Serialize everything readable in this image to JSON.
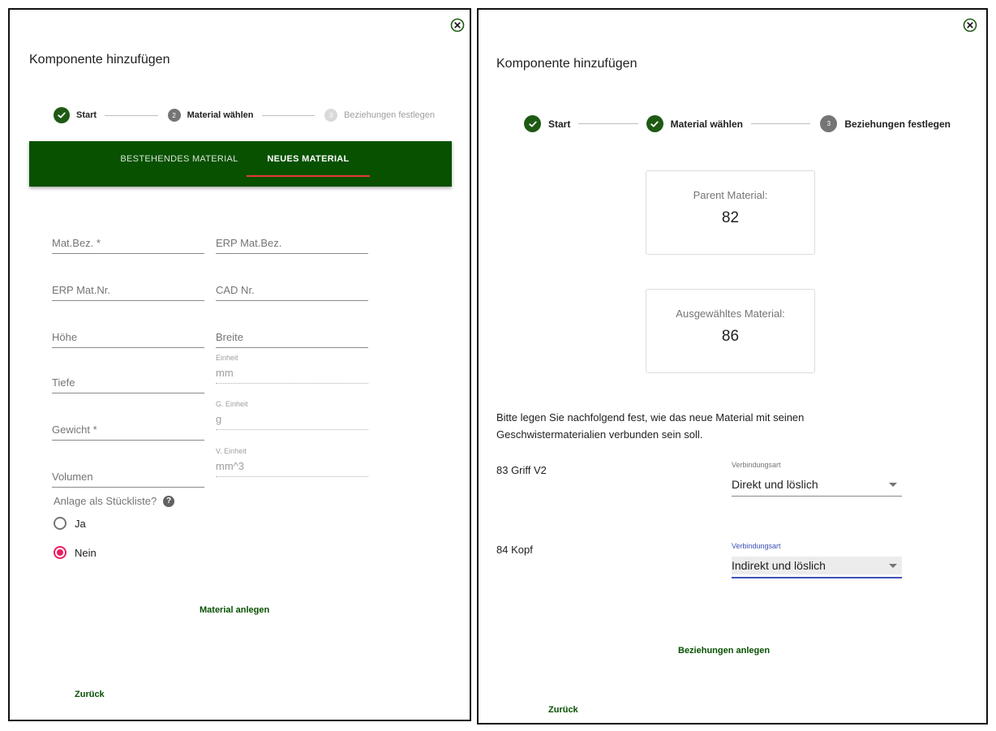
{
  "left": {
    "title": "Komponente hinzufügen",
    "stepper": [
      {
        "label": "Start",
        "state": "done"
      },
      {
        "number": "2",
        "label": "Material wählen",
        "state": "active"
      },
      {
        "number": "3",
        "label": "Beziehungen festlegen",
        "state": "pending"
      }
    ],
    "tabs": {
      "existing": "BESTEHENDES MATERIAL",
      "new": "NEUES MATERIAL",
      "selected": "new"
    },
    "fields": {
      "mat_bez": {
        "label": "",
        "placeholder": "Mat.Bez. *"
      },
      "erp_mat_bez": {
        "label": "",
        "placeholder": "ERP Mat.Bez."
      },
      "erp_mat_nr": {
        "label": "",
        "placeholder": "ERP Mat.Nr."
      },
      "cad_nr": {
        "label": "",
        "placeholder": "CAD Nr."
      },
      "hoehe": {
        "label": "",
        "placeholder": "Höhe"
      },
      "breite": {
        "label": "",
        "placeholder": "Breite"
      },
      "tiefe": {
        "label": "",
        "placeholder": "Tiefe"
      },
      "einheit": {
        "label": "Einheit",
        "value": "mm"
      },
      "gewicht": {
        "label": "",
        "placeholder": "Gewicht *"
      },
      "g_einheit": {
        "label": "G. Einheit",
        "value": "g"
      },
      "volumen": {
        "label": "",
        "placeholder": "Volumen"
      },
      "v_einheit": {
        "label": "V. Einheit",
        "value": "mm^3"
      }
    },
    "stueckliste": {
      "question": "Anlage als Stückliste?",
      "help": "?",
      "options": [
        "Ja",
        "Nein"
      ],
      "selected": "Nein"
    },
    "submit_label": "Material anlegen",
    "back_label": "Zurück"
  },
  "right": {
    "title": "Komponente hinzufügen",
    "stepper": [
      {
        "label": "Start",
        "state": "done"
      },
      {
        "label": "Material wählen",
        "state": "done"
      },
      {
        "number": "3",
        "label": "Beziehungen festlegen",
        "state": "active"
      }
    ],
    "parent": {
      "label": "Parent Material:",
      "value": "82"
    },
    "selected_material": {
      "label": "Ausgewähltes Material:",
      "value": "86"
    },
    "instructions": "Bitte legen Sie nachfolgend fest, wie das neue Material mit seinen Geschwistermaterialien verbunden sein soll.",
    "siblings": [
      {
        "name": "83 Griff V2",
        "select_label": "Verbindungsart",
        "value": "Direkt und löslich",
        "focused": false
      },
      {
        "name": "84 Kopf",
        "select_label": "Verbindungsart",
        "value": "Indirekt und löslich",
        "focused": true
      }
    ],
    "submit_label": "Beziehungen anlegen",
    "back_label": "Zurück"
  },
  "colors": {
    "primary_green": "#075100",
    "step_done": "#1e5a14",
    "tab_ink": "#e53935",
    "radio_accent": "#e91e63",
    "select_focus": "#3f51b5"
  },
  "icons": {
    "close": "close-circle-icon",
    "step_done": "check-circle-icon",
    "help": "help-circle-icon",
    "dropdown": "arrow-drop-down-icon"
  }
}
